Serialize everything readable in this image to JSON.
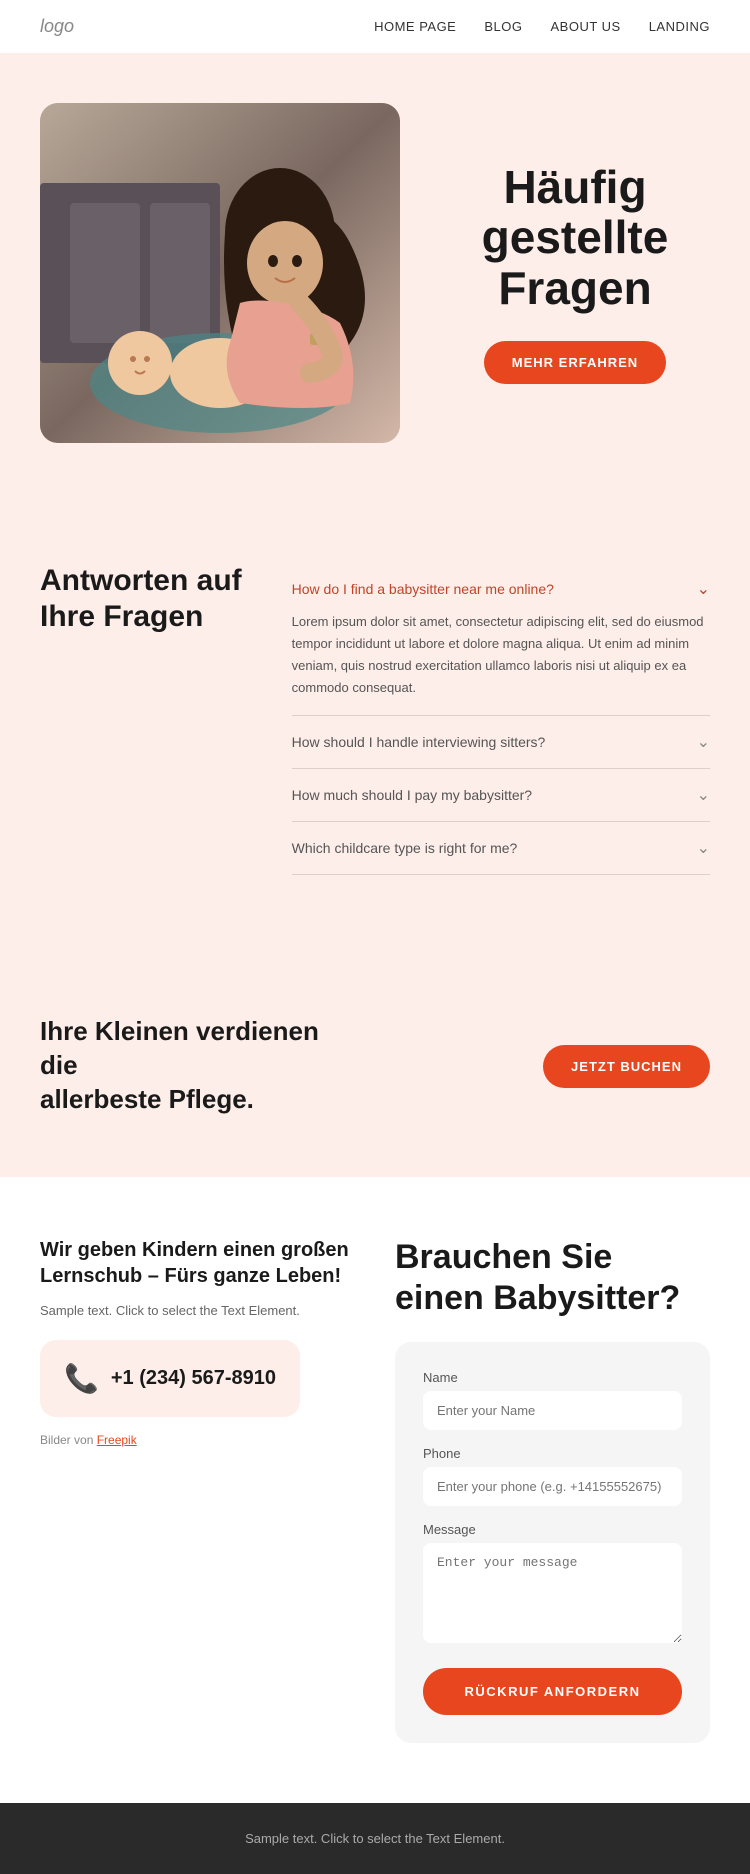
{
  "nav": {
    "logo": "logo",
    "links": [
      "HOME PAGE",
      "BLOG",
      "ABOUT US",
      "LANDING"
    ]
  },
  "hero": {
    "title": "Häufig gestellte Fragen",
    "button_label": "MEHR ERFAHREN"
  },
  "faq": {
    "heading_line1": "Antworten auf",
    "heading_line2": "Ihre Fragen",
    "items": [
      {
        "question": "How do I find a babysitter near me online?",
        "open": true,
        "answer": "Lorem ipsum dolor sit amet, consectetur adipiscing elit, sed do eiusmod tempor incididunt ut labore et dolore magna aliqua. Ut enim ad minim veniam, quis nostrud exercitation ullamco laboris nisi ut aliquip ex ea commodo consequat."
      },
      {
        "question": "How should I handle interviewing sitters?",
        "open": false,
        "answer": ""
      },
      {
        "question": "How much should I pay my babysitter?",
        "open": false,
        "answer": ""
      },
      {
        "question": "Which childcare type is right for me?",
        "open": false,
        "answer": ""
      }
    ]
  },
  "cta": {
    "text_line1": "Ihre Kleinen verdienen die",
    "text_line2": "allerbeste Pflege.",
    "button_label": "JETZT BUCHEN"
  },
  "contact": {
    "left": {
      "title": "Wir geben Kindern einen großen Lernschub – Fürs ganze Leben!",
      "sample_text": "Sample text. Click to select the Text Element.",
      "phone": "+1 (234) 567-8910",
      "photo_credit_prefix": "Bilder von ",
      "photo_credit_link": "Freepik"
    },
    "right": {
      "title": "Brauchen Sie einen Babysitter?",
      "form": {
        "name_label": "Name",
        "name_placeholder": "Enter your Name",
        "phone_label": "Phone",
        "phone_placeholder": "Enter your phone (e.g. +14155552675)",
        "message_label": "Message",
        "message_placeholder": "Enter your message",
        "submit_label": "RÜCKRUF ANFORDERN"
      }
    }
  },
  "footer": {
    "text": "Sample text. Click to select the Text Element."
  }
}
